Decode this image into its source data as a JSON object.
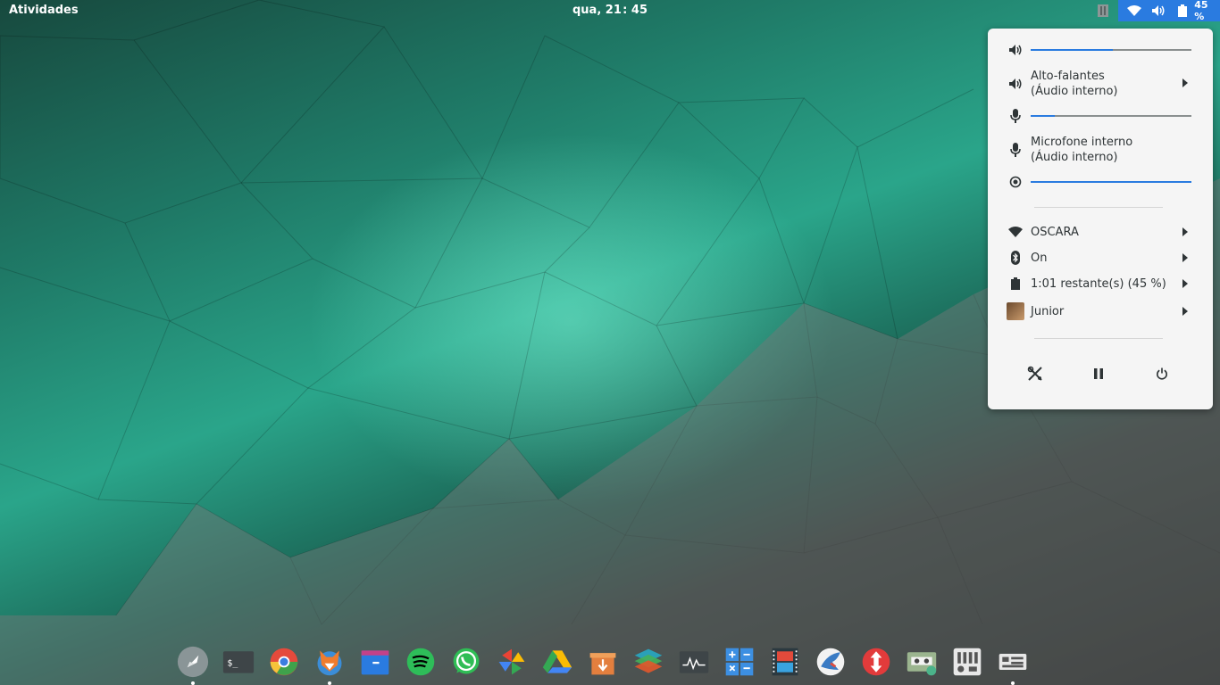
{
  "topbar": {
    "activities_label": "Atividades",
    "clock": "qua, 21 : 45",
    "status": {
      "battery_percent_text": "45 %",
      "icons": [
        "wifi-icon",
        "volume-icon",
        "battery-icon"
      ]
    }
  },
  "system_menu": {
    "volume": {
      "level": 0.51
    },
    "output_device": {
      "line1": "Alto-falantes",
      "line2": "(Áudio interno)"
    },
    "mic": {
      "level": 0.15
    },
    "input_device": {
      "line1": "Microfone interno",
      "line2": "(Áudio interno)"
    },
    "brightness": {
      "level": 1.0
    },
    "wifi": {
      "label": "OSCARA"
    },
    "bluetooth": {
      "label": "On"
    },
    "battery": {
      "label": "1:01 restante(s) (45 %)"
    },
    "user": {
      "label": "Junior"
    },
    "actions": [
      "settings-icon",
      "pause-icon",
      "power-icon"
    ]
  },
  "dock": {
    "items": [
      {
        "name": "launcher",
        "running": true
      },
      {
        "name": "terminal",
        "running": false
      },
      {
        "name": "chrome",
        "running": false
      },
      {
        "name": "fox-app",
        "running": true
      },
      {
        "name": "files",
        "running": false
      },
      {
        "name": "spotify",
        "running": false
      },
      {
        "name": "whatsapp",
        "running": false
      },
      {
        "name": "photos",
        "running": false
      },
      {
        "name": "drive",
        "running": false
      },
      {
        "name": "archive",
        "running": false
      },
      {
        "name": "layers",
        "running": false
      },
      {
        "name": "system-monitor",
        "running": false
      },
      {
        "name": "calculator",
        "running": false
      },
      {
        "name": "video-editor",
        "running": false
      },
      {
        "name": "bird-app",
        "running": false
      },
      {
        "name": "transmission",
        "running": false
      },
      {
        "name": "recorder",
        "running": false
      },
      {
        "name": "mixer",
        "running": false
      },
      {
        "name": "settings-app",
        "running": true
      }
    ]
  },
  "colors": {
    "accent": "#2a7be0",
    "menu_bg": "#f5f5f5"
  }
}
